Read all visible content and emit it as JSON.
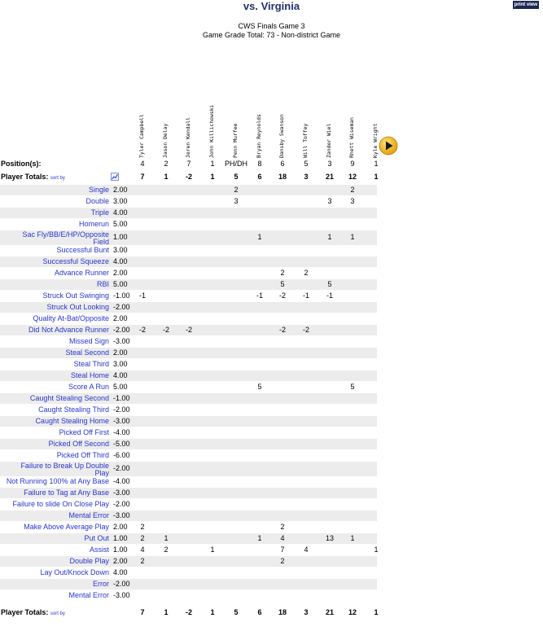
{
  "page": {
    "title": "vs. Virginia",
    "print_label": "print view",
    "subtitle1": "CWS Finals Game 3",
    "subtitle2": "Game Grade Total: 73 - Non-district Game"
  },
  "players": [
    "Tyler Campbell",
    "Jason Delay",
    "Jeren Kendall",
    "John Killichowski",
    "Penn Murfee",
    "Bryan Reynolds",
    "Dansby Swanson",
    "Will Toffey",
    "Zander Wiel",
    "Rhett Wiseman",
    "Kyle Wright"
  ],
  "positions_label": "Position(s):",
  "positions": [
    "4",
    "2",
    "7",
    "1",
    "PH/DH",
    "8",
    "6",
    "5",
    "3",
    "9",
    "1"
  ],
  "totals_label": "Player Totals:",
  "sort_by": "sort by",
  "totals": [
    "7",
    "1",
    "-2",
    "1",
    "5",
    "6",
    "18",
    "3",
    "21",
    "12",
    "1"
  ],
  "stats": [
    {
      "label": "Single",
      "value": "2.00",
      "cells": [
        "",
        "",
        "",
        "",
        "2",
        "",
        "",
        "",
        "",
        "2",
        ""
      ]
    },
    {
      "label": "Double",
      "value": "3.00",
      "cells": [
        "",
        "",
        "",
        "",
        "3",
        "",
        "",
        "",
        "3",
        "3",
        ""
      ]
    },
    {
      "label": "Triple",
      "value": "4.00",
      "cells": [
        "",
        "",
        "",
        "",
        "",
        "",
        "",
        "",
        "",
        "",
        ""
      ]
    },
    {
      "label": "Homerun",
      "value": "5.00",
      "cells": [
        "",
        "",
        "",
        "",
        "",
        "",
        "",
        "",
        "",
        "",
        ""
      ]
    },
    {
      "label": "Sac Fly/BB/E/HP/Opposite Field",
      "label1": "Sac Fly/BB/E/HP/Opposite",
      "label2": "Field",
      "value": "1.00",
      "cells": [
        "",
        "",
        "",
        "",
        "",
        "1",
        "",
        "",
        "1",
        "1",
        ""
      ]
    },
    {
      "label": "Successful Bunt",
      "value": "3.00",
      "cells": [
        "",
        "",
        "",
        "",
        "",
        "",
        "",
        "",
        "",
        "",
        ""
      ]
    },
    {
      "label": "Successful Squeeze",
      "value": "4.00",
      "cells": [
        "",
        "",
        "",
        "",
        "",
        "",
        "",
        "",
        "",
        "",
        ""
      ]
    },
    {
      "label": "Advance Runner",
      "value": "2.00",
      "cells": [
        "",
        "",
        "",
        "",
        "",
        "",
        "2",
        "2",
        "",
        "",
        ""
      ]
    },
    {
      "label": "RBI",
      "value": "5.00",
      "cells": [
        "",
        "",
        "",
        "",
        "",
        "",
        "5",
        "",
        "5",
        "",
        ""
      ]
    },
    {
      "label": "Struck Out Swinging",
      "value": "-1.00",
      "cells": [
        "-1",
        "",
        "",
        "",
        "",
        "-1",
        "-2",
        "-1",
        "-1",
        "",
        ""
      ]
    },
    {
      "label": "Struck Out Looking",
      "value": "-2.00",
      "cells": [
        "",
        "",
        "",
        "",
        "",
        "",
        "",
        "",
        "",
        "",
        ""
      ]
    },
    {
      "label": "Quality At-Bat/Opposite",
      "value": "2.00",
      "cells": [
        "",
        "",
        "",
        "",
        "",
        "",
        "",
        "",
        "",
        "",
        ""
      ]
    },
    {
      "label": "Did Not Advance Runner",
      "value": "-2.00",
      "cells": [
        "-2",
        "-2",
        "-2",
        "",
        "",
        "",
        "-2",
        "-2",
        "",
        "",
        ""
      ]
    },
    {
      "label": "Missed Sign",
      "value": "-3.00",
      "cells": [
        "",
        "",
        "",
        "",
        "",
        "",
        "",
        "",
        "",
        "",
        ""
      ]
    },
    {
      "label": "Steal Second",
      "value": "2.00",
      "cells": [
        "",
        "",
        "",
        "",
        "",
        "",
        "",
        "",
        "",
        "",
        ""
      ]
    },
    {
      "label": "Steal Third",
      "value": "3.00",
      "cells": [
        "",
        "",
        "",
        "",
        "",
        "",
        "",
        "",
        "",
        "",
        ""
      ]
    },
    {
      "label": "Steal Home",
      "value": "4.00",
      "cells": [
        "",
        "",
        "",
        "",
        "",
        "",
        "",
        "",
        "",
        "",
        ""
      ]
    },
    {
      "label": "Score A Run",
      "value": "5.00",
      "cells": [
        "",
        "",
        "",
        "",
        "",
        "5",
        "",
        "",
        "",
        "5",
        ""
      ]
    },
    {
      "label": "Caught Stealing Second",
      "value": "-1.00",
      "cells": [
        "",
        "",
        "",
        "",
        "",
        "",
        "",
        "",
        "",
        "",
        ""
      ]
    },
    {
      "label": "Caught Stealing Third",
      "value": "-2.00",
      "cells": [
        "",
        "",
        "",
        "",
        "",
        "",
        "",
        "",
        "",
        "",
        ""
      ]
    },
    {
      "label": "Caught Stealing Home",
      "value": "-3.00",
      "cells": [
        "",
        "",
        "",
        "",
        "",
        "",
        "",
        "",
        "",
        "",
        ""
      ]
    },
    {
      "label": "Picked Off First",
      "value": "-4.00",
      "cells": [
        "",
        "",
        "",
        "",
        "",
        "",
        "",
        "",
        "",
        "",
        ""
      ]
    },
    {
      "label": "Picked Off Second",
      "value": "-5.00",
      "cells": [
        "",
        "",
        "",
        "",
        "",
        "",
        "",
        "",
        "",
        "",
        ""
      ]
    },
    {
      "label": "Picked Off Third",
      "value": "-6.00",
      "cells": [
        "",
        "",
        "",
        "",
        "",
        "",
        "",
        "",
        "",
        "",
        ""
      ]
    },
    {
      "label": "Failure to Break Up Double Play",
      "label1": "Failure to Break Up Double",
      "label2": "Play",
      "value": "-2.00",
      "cells": [
        "",
        "",
        "",
        "",
        "",
        "",
        "",
        "",
        "",
        "",
        ""
      ]
    },
    {
      "label": "Not Running 100% at Any Base",
      "value": "-4.00",
      "cells": [
        "",
        "",
        "",
        "",
        "",
        "",
        "",
        "",
        "",
        "",
        ""
      ]
    },
    {
      "label": "Failure to Tag at Any Base",
      "value": "-3.00",
      "cells": [
        "",
        "",
        "",
        "",
        "",
        "",
        "",
        "",
        "",
        "",
        ""
      ]
    },
    {
      "label": "Failure to slide On Close Play",
      "value": "-2.00",
      "cells": [
        "",
        "",
        "",
        "",
        "",
        "",
        "",
        "",
        "",
        "",
        ""
      ]
    },
    {
      "label": "Mental Error",
      "value": "-3.00",
      "cells": [
        "",
        "",
        "",
        "",
        "",
        "",
        "",
        "",
        "",
        "",
        ""
      ]
    },
    {
      "label": "Make Above Average Play",
      "value": "2.00",
      "cells": [
        "2",
        "",
        "",
        "",
        "",
        "",
        "2",
        "",
        "",
        "",
        ""
      ]
    },
    {
      "label": "Put Out",
      "value": "1.00",
      "cells": [
        "2",
        "1",
        "",
        "",
        "",
        "1",
        "4",
        "",
        "13",
        "1",
        ""
      ]
    },
    {
      "label": "Assist",
      "value": "1.00",
      "cells": [
        "4",
        "2",
        "",
        "1",
        "",
        "",
        "7",
        "4",
        "",
        "",
        "1"
      ]
    },
    {
      "label": "Double Play",
      "value": "2.00",
      "cells": [
        "2",
        "",
        "",
        "",
        "",
        "",
        "2",
        "",
        "",
        "",
        ""
      ]
    },
    {
      "label": "Lay Out/Knock Down",
      "value": "4.00",
      "cells": [
        "",
        "",
        "",
        "",
        "",
        "",
        "",
        "",
        "",
        "",
        ""
      ]
    },
    {
      "label": "Error",
      "value": "-2.00",
      "cells": [
        "",
        "",
        "",
        "",
        "",
        "",
        "",
        "",
        "",
        "",
        ""
      ]
    },
    {
      "label": "Mental Error",
      "value": "-3.00",
      "cells": [
        "",
        "",
        "",
        "",
        "",
        "",
        "",
        "",
        "",
        "",
        ""
      ]
    }
  ]
}
